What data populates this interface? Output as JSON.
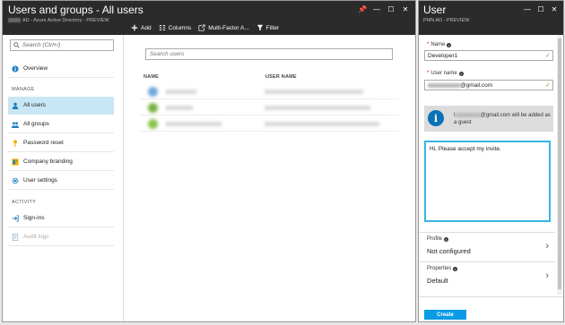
{
  "left_blade": {
    "title": "Users and groups - All users",
    "subtitle": "AD - Azure Active Directory - PREVIEW",
    "toolbar": {
      "add": "Add",
      "columns": "Columns",
      "mfa": "Multi-Factor A...",
      "filter": "Filter"
    },
    "nav": {
      "search_placeholder": "Search (Ctrl+/)",
      "overview": "Overview",
      "section_manage": "MANAGE",
      "all_users": "All users",
      "all_groups": "All groups",
      "password_reset": "Password reset",
      "company_branding": "Company branding",
      "user_settings": "User settings",
      "section_activity": "ACTIVITY",
      "sign_ins": "Sign-ins",
      "audit_logs": "Audit logs"
    },
    "list": {
      "search_placeholder": "Search users",
      "col_name": "NAME",
      "col_username": "USER NAME"
    }
  },
  "right_blade": {
    "title": "User",
    "subtitle": "PMN AD - PREVIEW",
    "name_label": "Name",
    "name_value": "Developer1",
    "username_label": "User name",
    "username_suffix": "@gmail.com",
    "info_prefix": "t",
    "info_msg": "@gmail.com will be added as a guest",
    "invite_text": "Hi, Please accept my invite.",
    "profile_label": "Profile",
    "profile_value": "Not configured",
    "properties_label": "Properties",
    "properties_value": "Default",
    "create": "Create"
  }
}
